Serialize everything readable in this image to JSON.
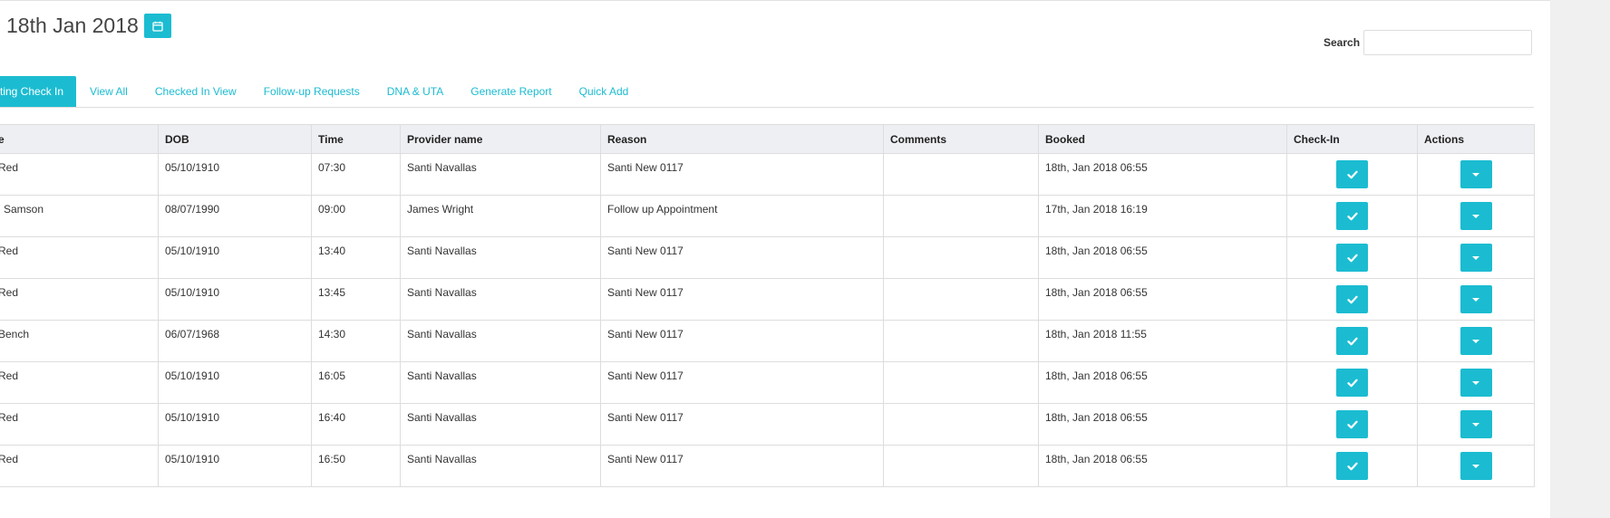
{
  "header": {
    "date_title": "18th Jan 2018",
    "calendar_icon": "calendar-icon"
  },
  "search": {
    "label": "Search",
    "value": "",
    "placeholder": ""
  },
  "tabs": [
    {
      "label": "ting Check In",
      "active": true
    },
    {
      "label": "View All"
    },
    {
      "label": "Checked In View"
    },
    {
      "label": "Follow-up Requests"
    },
    {
      "label": "DNA & UTA"
    },
    {
      "label": "Generate Report"
    },
    {
      "label": "Quick Add"
    }
  ],
  "table": {
    "columns": [
      "e",
      "DOB",
      "Time",
      "Provider name",
      "Reason",
      "Comments",
      "Booked",
      "Check-In",
      "Actions"
    ],
    "rows": [
      {
        "name": "Red",
        "dob": "05/10/1910",
        "time": "07:30",
        "provider": "Santi Navallas",
        "reason": "Santi New 0117",
        "comments": "",
        "booked": "18th, Jan 2018 06:55"
      },
      {
        "name": "l Samson",
        "dob": "08/07/1990",
        "time": "09:00",
        "provider": "James Wright",
        "reason": "Follow up Appointment",
        "comments": "",
        "booked": "17th, Jan 2018 16:19"
      },
      {
        "name": "Red",
        "dob": "05/10/1910",
        "time": "13:40",
        "provider": "Santi Navallas",
        "reason": "Santi New 0117",
        "comments": "",
        "booked": "18th, Jan 2018 06:55"
      },
      {
        "name": "Red",
        "dob": "05/10/1910",
        "time": "13:45",
        "provider": "Santi Navallas",
        "reason": "Santi New 0117",
        "comments": "",
        "booked": "18th, Jan 2018 06:55"
      },
      {
        "name": "Bench",
        "dob": "06/07/1968",
        "time": "14:30",
        "provider": "Santi Navallas",
        "reason": "Santi New 0117",
        "comments": "",
        "booked": "18th, Jan 2018 11:55"
      },
      {
        "name": "Red",
        "dob": "05/10/1910",
        "time": "16:05",
        "provider": "Santi Navallas",
        "reason": "Santi New 0117",
        "comments": "",
        "booked": "18th, Jan 2018 06:55"
      },
      {
        "name": "Red",
        "dob": "05/10/1910",
        "time": "16:40",
        "provider": "Santi Navallas",
        "reason": "Santi New 0117",
        "comments": "",
        "booked": "18th, Jan 2018 06:55"
      },
      {
        "name": "Red",
        "dob": "05/10/1910",
        "time": "16:50",
        "provider": "Santi Navallas",
        "reason": "Santi New 0117",
        "comments": "",
        "booked": "18th, Jan 2018 06:55"
      }
    ],
    "checkin_icon": "check-icon",
    "action_icon": "caret-down-icon"
  },
  "colors": {
    "accent": "#1bbcd1",
    "header_bg": "#eeeff3",
    "border": "#dddddd"
  }
}
